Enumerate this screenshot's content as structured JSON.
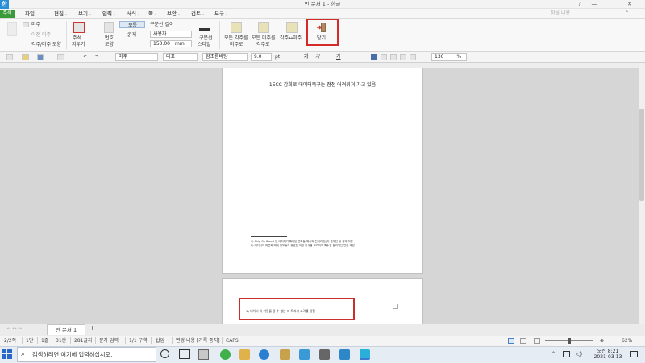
{
  "window": {
    "title": "빈 문서 1 - 한글",
    "logo": "한",
    "minimize": "—",
    "maximize": "□",
    "close": "✕",
    "ribbon_toggle": "⌃",
    "help": "?"
  },
  "menubar": {
    "badge": "주석",
    "items": [
      {
        "label": "파일",
        "arrow": ""
      },
      {
        "label": "편집",
        "arrow": "▾"
      },
      {
        "label": "보기",
        "arrow": "▾"
      },
      {
        "label": "입력",
        "arrow": "▾"
      },
      {
        "label": "서식",
        "arrow": "▾"
      },
      {
        "label": "쪽",
        "arrow": "▾"
      },
      {
        "label": "보안",
        "arrow": "▾"
      },
      {
        "label": "검토",
        "arrow": "▾"
      },
      {
        "label": "도구",
        "arrow": "▾"
      }
    ],
    "search_placeholder": "찾을 내용"
  },
  "ribbon": {
    "g1": {
      "label": "미주",
      "sub1": "이전 미주",
      "sub2": "각주/미주 모양"
    },
    "g2": {
      "label1": "주석",
      "label2": "지우기"
    },
    "g3": {
      "label1": "번호",
      "label2": "모양"
    },
    "g4": {
      "opt1": "보통",
      "opt2": "굵게"
    },
    "g5": {
      "caption": "구분선 길이",
      "select_value": "사용자",
      "size_value": "150.00",
      "size_unit": "mm"
    },
    "g6": {
      "label1": "구분선",
      "label2": "스타일"
    },
    "g7": {
      "label1": "모든 각주를",
      "label2": "미주로"
    },
    "g8": {
      "label1": "모든 미주를",
      "label2": "각주로"
    },
    "g9": {
      "label": "각주↔미주"
    },
    "close": {
      "label": "닫기"
    }
  },
  "toolbar": {
    "style": "미주",
    "lang": "대표",
    "font": "함초롬바탕",
    "size": "9.0",
    "size_unit": "pt",
    "bold": "가",
    "italic": "가",
    "underline": "가",
    "zoom": "130",
    "zoom_unit": "%"
  },
  "document": {
    "heading": "1ECC 감회로 데이터복구는 점점 어려워져 가고 있음",
    "footnote1": "1) Chip On Board 등 데이터가 특화된 변화들(해시와 전처리 등)이 존재한 뒤 칩에 저장",
    "footnote2": "2) 데이터의 파편화 해제 정보들의 유효한 저장 방식을 고려하여 특수한 물리적인 변환 과정",
    "page2_text": "1) 데이터 의 기밀을 알 수 없는 지 트리가 고려를 말함"
  },
  "tabs": {
    "doc_tab": "빈 문서 1",
    "add": "+"
  },
  "status": {
    "page": "2/2쪽",
    "section": "1단",
    "line": "1줄",
    "col": "31칸",
    "chars": "281글자",
    "mode": "문자 입력",
    "area": "1/1 구역",
    "insert": "삽입",
    "track": "변경 내용 [기록 중지]",
    "caps": "CAPS",
    "zoom_pct": "62%"
  },
  "taskbar": {
    "search_placeholder": "검색하려면 여기에 입력하십시오.",
    "time": "오전 8:21",
    "date": "2021-03-13"
  }
}
